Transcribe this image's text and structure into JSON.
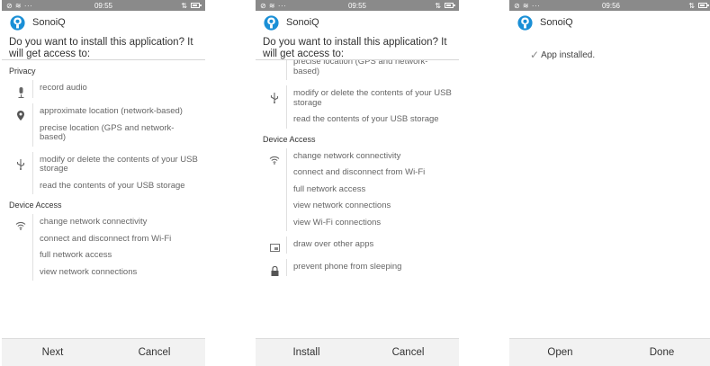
{
  "status_bar": {
    "left_icons": "⊘ ≋ ···"
  },
  "screens": [
    {
      "time": "09:55",
      "app_name": "SonoiQ",
      "question": "Do you want to install this application? It will get access to:",
      "privacy_title": "Privacy",
      "privacy": {
        "microphone": [
          "record audio"
        ],
        "location": [
          "approximate location (network-based)",
          "precise location (GPS and network-based)"
        ],
        "usb": [
          "modify or delete the contents of your USB storage",
          "read the contents of your USB storage"
        ]
      },
      "device_title": "Device Access",
      "device": {
        "network": [
          "change network connectivity",
          "connect and disconnect from Wi-Fi",
          "full network access",
          "view network connections"
        ]
      },
      "buttons": {
        "primary": "Next",
        "secondary": "Cancel"
      }
    },
    {
      "time": "09:55",
      "app_name": "SonoiQ",
      "question": "Do you want to install this application? It will get access to:",
      "privacy": {
        "location_cut": [
          "precise location (GPS and network-based)"
        ],
        "usb": [
          "modify or delete the contents of your USB storage",
          "read the contents of your USB storage"
        ]
      },
      "device_title": "Device Access",
      "device": {
        "network": [
          "change network connectivity",
          "connect and disconnect from Wi-Fi",
          "full network access",
          "view network connections",
          "view Wi-Fi connections"
        ],
        "overlay": [
          "draw over other apps"
        ],
        "wakelock": [
          "prevent phone from sleeping"
        ]
      },
      "buttons": {
        "primary": "Install",
        "secondary": "Cancel"
      }
    },
    {
      "time": "09:56",
      "app_name": "SonoiQ",
      "message": "App installed.",
      "buttons": {
        "primary": "Open",
        "secondary": "Done"
      }
    }
  ],
  "icons": {
    "app_logo": "sonoiq-logo-icon",
    "microphone": "microphone-icon",
    "location": "location-pin-icon",
    "usb": "usb-icon",
    "wifi": "wifi-icon",
    "overlay": "overlay-window-icon",
    "lock": "lock-icon",
    "check": "checkmark-icon"
  },
  "colors": {
    "status_bar": "#8a8a8a",
    "logo_blue": "#1a8fd6",
    "button_bar": "#f2f2f2",
    "text": "#333333",
    "secondary_text": "#666666"
  }
}
